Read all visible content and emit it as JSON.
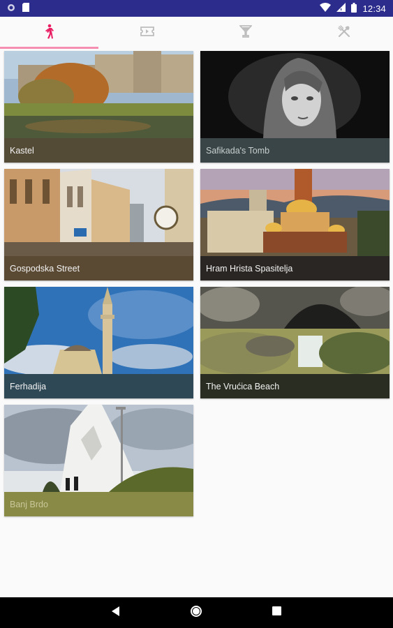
{
  "status_bar": {
    "time": "12:34",
    "icons": [
      "notification-dot-icon",
      "sd-card-icon",
      "wifi-icon",
      "signal-icon",
      "battery-icon"
    ]
  },
  "tabs": [
    {
      "icon": "walking-person-icon",
      "active": true,
      "color": "#e91e63"
    },
    {
      "icon": "ticket-icon",
      "active": false,
      "color": "#bdbdbd"
    },
    {
      "icon": "cocktail-glass-icon",
      "active": false,
      "color": "#bdbdbd"
    },
    {
      "icon": "fork-knife-icon",
      "active": false,
      "color": "#bdbdbd"
    }
  ],
  "places": [
    {
      "name": "Kastel",
      "caption_bg": "#544b36"
    },
    {
      "name": "Safikada's Tomb",
      "caption_bg": "#394546"
    },
    {
      "name": "Gospodska Street",
      "caption_bg": "#5a4a33"
    },
    {
      "name": "Hram Hrista Spasitelja",
      "caption_bg": "#2a2623"
    },
    {
      "name": "Ferhadija",
      "caption_bg": "#2f4856"
    },
    {
      "name": "The Vrućica Beach",
      "caption_bg": "#2a2e22"
    },
    {
      "name": "Banj Brdo",
      "caption_bg": "#8a8a47"
    }
  ],
  "nav_bar": {
    "buttons": [
      "back-icon",
      "home-icon",
      "recents-icon"
    ]
  }
}
